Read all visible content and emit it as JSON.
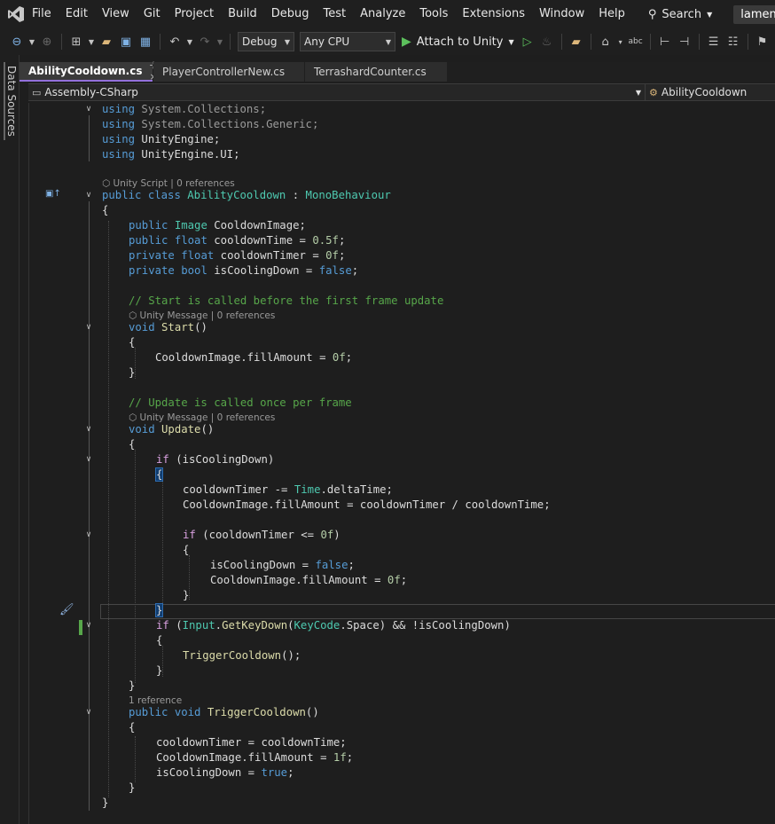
{
  "menubar": {
    "items": [
      "File",
      "Edit",
      "View",
      "Git",
      "Project",
      "Build",
      "Debug",
      "Test",
      "Analyze",
      "Tools",
      "Extensions",
      "Window",
      "Help"
    ],
    "search_label": "Search",
    "solution_name": "lament"
  },
  "toolbar": {
    "configuration": "Debug",
    "platform": "Any CPU",
    "attach_label": "Attach to Unity"
  },
  "left_panel": {
    "tab_label": "Data Sources"
  },
  "tabs": [
    {
      "label": "AbilityCooldown.cs",
      "active": true,
      "icons": "⊹ ×"
    },
    {
      "label": "PlayerControllerNew.cs",
      "active": false
    },
    {
      "label": "TerrashardCounter.cs",
      "active": false
    }
  ],
  "navbar": {
    "project": "Assembly-CSharp",
    "class_member": "AbilityCooldown"
  },
  "codelens": {
    "class": "Unity Script | 0 references",
    "start": "Unity Message | 0 references",
    "update": "Unity Message | 0 references",
    "trigger": "1 reference"
  },
  "code": {
    "l1": [
      "using",
      " System",
      ".",
      "Collections",
      ";"
    ],
    "l2": [
      "using",
      " System",
      ".",
      "Collections",
      ".",
      "Generic",
      ";"
    ],
    "l3": [
      "using",
      " UnityEngine",
      ";"
    ],
    "l4": [
      "using",
      " UnityEngine",
      ".",
      "UI",
      ";"
    ],
    "l6": [
      "public",
      " ",
      "class",
      " ",
      "AbilityCooldown",
      " : ",
      "MonoBehaviour"
    ],
    "l7": "{",
    "l8": [
      "public",
      " ",
      "Image",
      " CooldownImage;"
    ],
    "l9": [
      "public",
      " ",
      "float",
      " cooldownTime = ",
      "0.5f",
      ";"
    ],
    "l10": [
      "private",
      " ",
      "float",
      " cooldownTimer = ",
      "0f",
      ";"
    ],
    "l11": [
      "private",
      " ",
      "bool",
      " isCoolingDown = ",
      "false",
      ";"
    ],
    "l13": "// Start is called before the first frame update",
    "l14": [
      "void",
      " ",
      "Start",
      "()"
    ],
    "l15": "{",
    "l16": [
      "CooldownImage",
      ".",
      "fillAmount",
      " = ",
      "0f",
      ";"
    ],
    "l17": "}",
    "l19": "// Update is called once per frame",
    "l20": [
      "void",
      " ",
      "Update",
      "()"
    ],
    "l21": "{",
    "l22": [
      "if",
      " (isCoolingDown)"
    ],
    "l23": "{",
    "l24": [
      "cooldownTimer -= ",
      "Time",
      ".",
      "deltaTime",
      ";"
    ],
    "l25": [
      "CooldownImage",
      ".",
      "fillAmount",
      " = cooldownTimer / cooldownTime;"
    ],
    "l27": [
      "if",
      " (cooldownTimer <= ",
      "0f",
      ")"
    ],
    "l28": "{",
    "l29": [
      "isCoolingDown = ",
      "false",
      ";"
    ],
    "l30": [
      "CooldownImage",
      ".",
      "fillAmount",
      " = ",
      "0f",
      ";"
    ],
    "l31": "}",
    "l32": "}",
    "l33": [
      "if",
      " (",
      "Input",
      ".",
      "GetKeyDown",
      "(",
      "KeyCode",
      ".",
      "Space",
      ") && !isCoolingDown)"
    ],
    "l34": "{",
    "l35": [
      "TriggerCooldown",
      "();"
    ],
    "l36": "}",
    "l37": "}",
    "l38": [
      "public",
      " ",
      "void",
      " ",
      "TriggerCooldown",
      "()"
    ],
    "l39": "{",
    "l40": [
      "cooldownTimer = cooldownTime;"
    ],
    "l41": [
      "CooldownImage",
      ".",
      "fillAmount",
      " = ",
      "1f",
      ";"
    ],
    "l42": [
      "isCoolingDown = ",
      "true",
      ";"
    ],
    "l43": "}",
    "l44": "}"
  }
}
